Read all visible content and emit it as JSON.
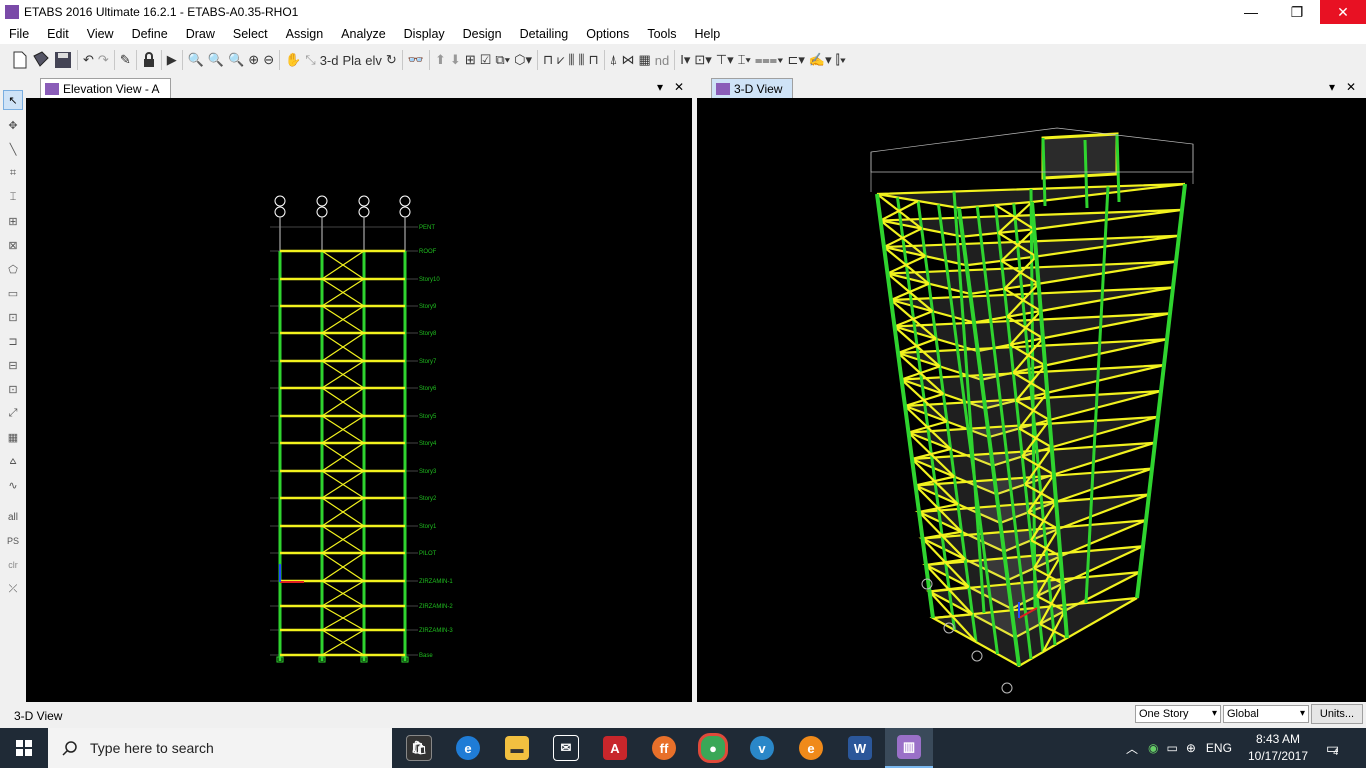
{
  "window": {
    "title": "ETABS 2016 Ultimate 16.2.1 - ETABS-A0.35-RHO1",
    "minimize": "—",
    "restore": "❐",
    "close": "✕"
  },
  "menu": [
    "File",
    "Edit",
    "View",
    "Define",
    "Draw",
    "Select",
    "Assign",
    "Analyze",
    "Display",
    "Design",
    "Detailing",
    "Options",
    "Tools",
    "Help"
  ],
  "toolbar": {
    "label_3d": "3-d",
    "label_pla": "Pla",
    "label_elv": "elv",
    "label_nd": "nd"
  },
  "left_toolbar": {
    "all": "all",
    "ps": "PS",
    "clr": "clr"
  },
  "left_pane": {
    "tab_label": "Elevation View - A",
    "story_labels": [
      "PENT",
      "ROOF",
      "Story10",
      "Story9",
      "Story8",
      "Story7",
      "Story6",
      "Story5",
      "Story4",
      "Story3",
      "Story2",
      "Story1",
      "PILOT",
      "ZIRZAMIN-1",
      "ZIRZAMIN-2",
      "ZIRZAMIN-3",
      "Base"
    ]
  },
  "right_pane": {
    "tab_label": "3-D View"
  },
  "pane_controls": {
    "dropdown": "▾",
    "close": "✕"
  },
  "status": {
    "text": "3-D View",
    "story_select": "One Story",
    "coord_select": "Global",
    "units_button": "Units..."
  },
  "taskbar": {
    "search_placeholder": "Type here to search",
    "language": "ENG",
    "time": "8:43 AM",
    "date": "10/17/2017",
    "notifications": "4"
  },
  "colors": {
    "frame_green": "#2fd42f",
    "brace_yellow": "#f2f21e",
    "label_green": "#1fbf1f",
    "canvas_bg": "#000000",
    "taskbar_bg": "#1f2a36"
  }
}
